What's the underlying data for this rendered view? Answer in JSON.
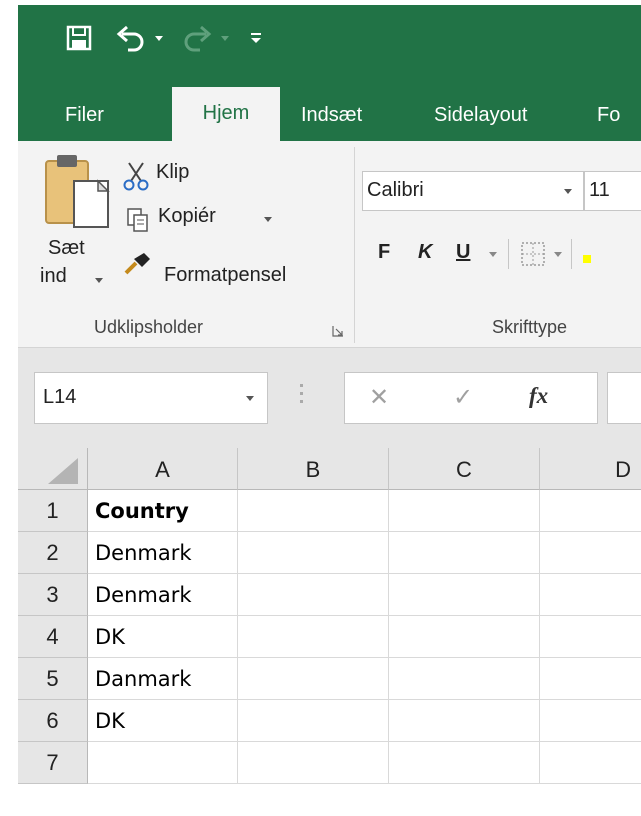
{
  "quick_access": {
    "save_icon": "save-icon",
    "undo_icon": "undo-icon",
    "redo_icon": "redo-icon",
    "customize_icon": "customize-qat-icon"
  },
  "tabs": [
    "Filer",
    "Hjem",
    "Indsæt",
    "Sidelayout",
    "Fo"
  ],
  "active_tab": "Hjem",
  "clipboard": {
    "paste_line1": "Sæt",
    "paste_line2": "ind",
    "cut_label": "Klip",
    "copy_label": "Kopiér",
    "format_painter_label": "Formatpensel",
    "group_label": "Udklipsholder"
  },
  "font": {
    "font_name": "Calibri",
    "font_size": "11",
    "bold_label": "F",
    "italic_label": "K",
    "underline_label": "U",
    "group_label": "Skrifttype"
  },
  "formula_bar": {
    "name_box": "L14",
    "fx_label": "fx",
    "cancel_glyph": "✕",
    "enter_glyph": "✓"
  },
  "columns": [
    "A",
    "B",
    "C",
    "D"
  ],
  "rows": [
    "1",
    "2",
    "3",
    "4",
    "5",
    "6",
    "7"
  ],
  "cells_A": [
    "Country",
    "Denmark",
    "Denmark",
    "DK",
    "Danmark",
    "DK",
    ""
  ],
  "colors": {
    "brand": "#217346",
    "ribbon": "#f3f3f3",
    "header": "#e6e6e6"
  }
}
